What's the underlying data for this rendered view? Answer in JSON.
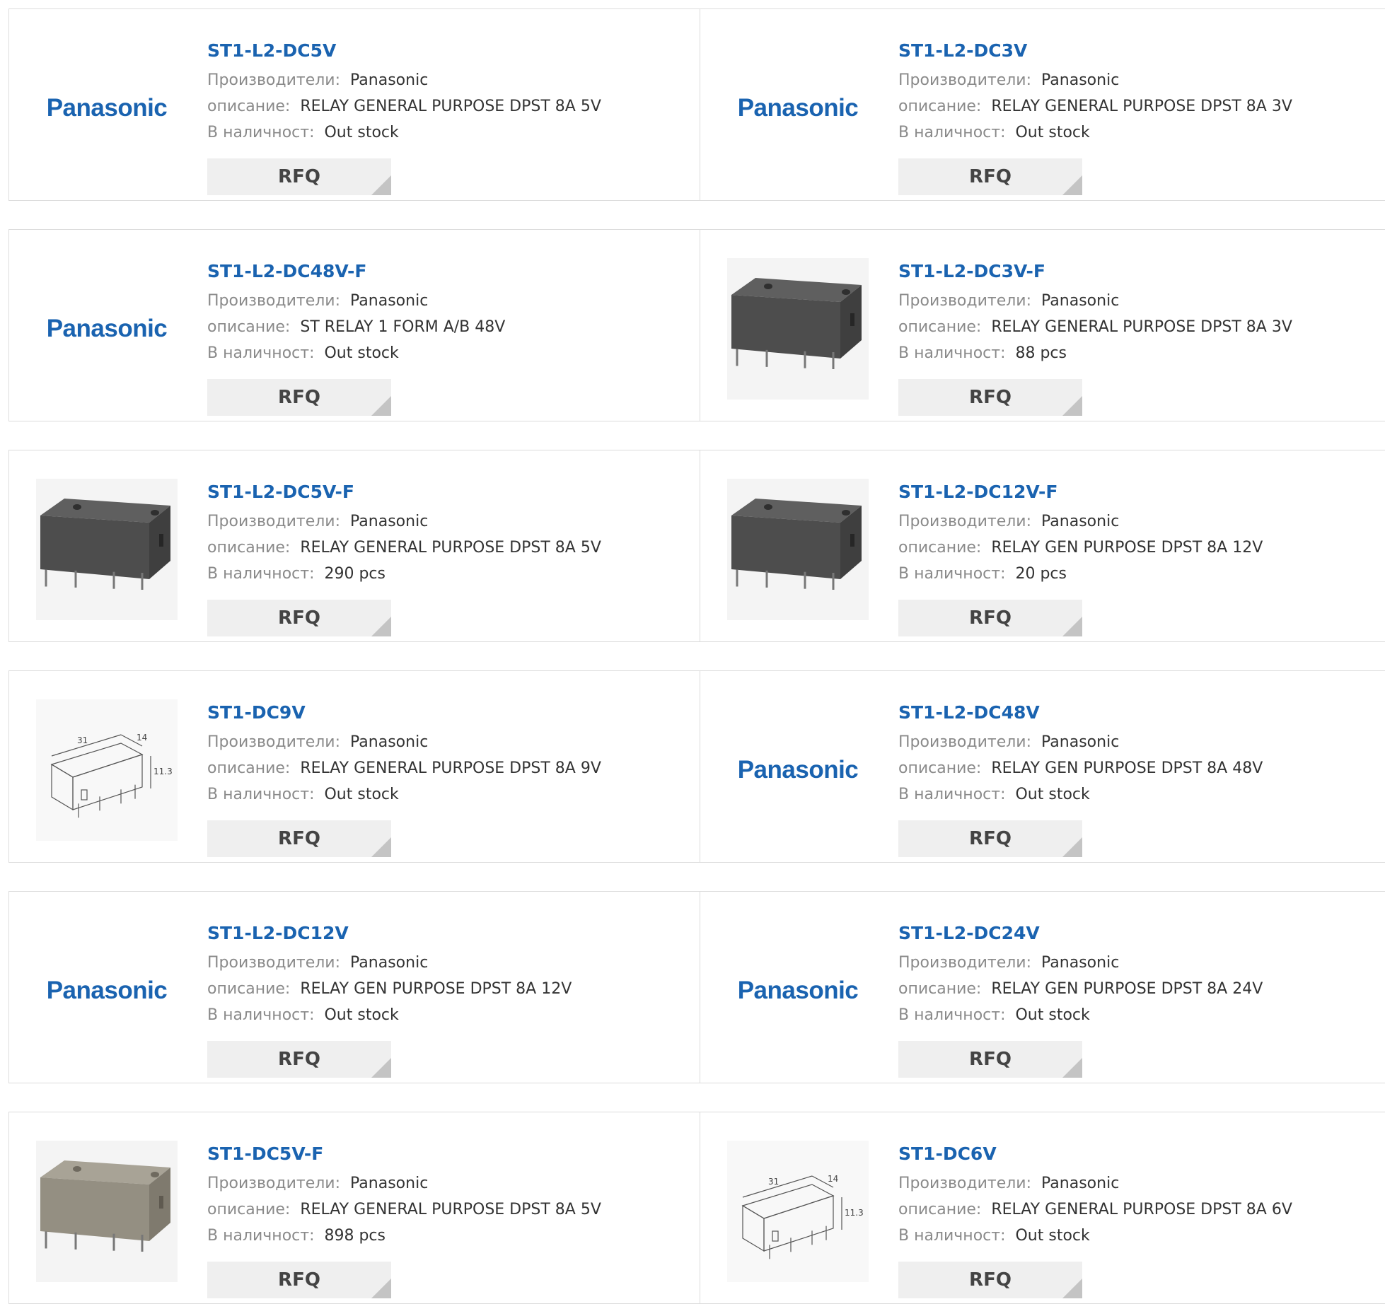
{
  "labels": {
    "manufacturer": "Производители:",
    "description": "описание:",
    "stock": "В наличност:",
    "rfq": "RFQ"
  },
  "brand_color": "#1a63b0",
  "products": [
    {
      "part": "ST1-L2-DC5V",
      "manufacturer": "Panasonic",
      "description": "RELAY GENERAL PURPOSE DPST 8A 5V",
      "stock": "Out stock",
      "image": "logo",
      "logo_text": "Panasonic"
    },
    {
      "part": "ST1-L2-DC3V",
      "manufacturer": "Panasonic",
      "description": "RELAY GENERAL PURPOSE DPST 8A 3V",
      "stock": "Out stock",
      "image": "logo",
      "logo_text": "Panasonic"
    },
    {
      "part": "ST1-L2-DC48V-F",
      "manufacturer": "Panasonic",
      "description": "ST RELAY 1 FORM A/B 48V",
      "stock": "Out stock",
      "image": "logo",
      "logo_text": "Panasonic"
    },
    {
      "part": "ST1-L2-DC3V-F",
      "manufacturer": "Panasonic",
      "description": "RELAY GENERAL PURPOSE DPST 8A 3V",
      "stock": "88 pcs",
      "image": "relay-dark"
    },
    {
      "part": "ST1-L2-DC5V-F",
      "manufacturer": "Panasonic",
      "description": "RELAY GENERAL PURPOSE DPST 8A 5V",
      "stock": "290 pcs",
      "image": "relay-dark"
    },
    {
      "part": "ST1-L2-DC12V-F",
      "manufacturer": "Panasonic",
      "description": "RELAY GEN PURPOSE DPST 8A 12V",
      "stock": "20 pcs",
      "image": "relay-dark"
    },
    {
      "part": "ST1-DC9V",
      "manufacturer": "Panasonic",
      "description": "RELAY GENERAL PURPOSE DPST 8A 9V",
      "stock": "Out stock",
      "image": "relay-drawing",
      "dims": [
        "31",
        "14",
        "11.3"
      ]
    },
    {
      "part": "ST1-L2-DC48V",
      "manufacturer": "Panasonic",
      "description": "RELAY GEN PURPOSE DPST 8A 48V",
      "stock": "Out stock",
      "image": "logo",
      "logo_text": "Panasonic"
    },
    {
      "part": "ST1-L2-DC12V",
      "manufacturer": "Panasonic",
      "description": "RELAY GEN PURPOSE DPST 8A 12V",
      "stock": "Out stock",
      "image": "logo",
      "logo_text": "Panasonic"
    },
    {
      "part": "ST1-L2-DC24V",
      "manufacturer": "Panasonic",
      "description": "RELAY GEN PURPOSE DPST 8A 24V",
      "stock": "Out stock",
      "image": "logo",
      "logo_text": "Panasonic"
    },
    {
      "part": "ST1-DC5V-F",
      "manufacturer": "Panasonic",
      "description": "RELAY GENERAL PURPOSE DPST 8A 5V",
      "stock": "898 pcs",
      "image": "relay-beige"
    },
    {
      "part": "ST1-DC6V",
      "manufacturer": "Panasonic",
      "description": "RELAY GENERAL PURPOSE DPST 8A 6V",
      "stock": "Out stock",
      "image": "relay-drawing",
      "dims": [
        "31",
        "14",
        "11.3"
      ]
    }
  ]
}
